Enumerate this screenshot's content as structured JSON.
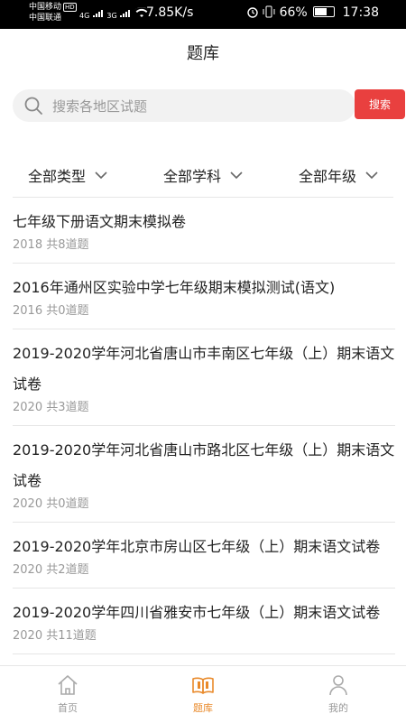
{
  "status_bar": {
    "carrier1": "中国移动",
    "carrier1_badge": "HD",
    "carrier2": "中国联通",
    "network": "4G",
    "network2": "3G",
    "speed": "7.85K/s",
    "battery": "66%",
    "time": "17:38"
  },
  "header": {
    "title": "题库"
  },
  "search": {
    "placeholder": "搜索各地区试题",
    "value": "",
    "button_label": "搜索"
  },
  "filters": [
    "全部类型",
    "全部学科",
    "全部年级"
  ],
  "list": [
    {
      "title": "七年级下册语文期末模拟卷",
      "meta": "2018 共8道题"
    },
    {
      "title": "2016年通州区实验中学七年级期末模拟测试(语文)",
      "meta": "2016 共0道题"
    },
    {
      "title": "2019-2020学年河北省唐山市丰南区七年级（上）期末语文试卷",
      "meta": "2020 共3道题"
    },
    {
      "title": "2019-2020学年河北省唐山市路北区七年级（上）期末语文试卷",
      "meta": "2020 共0道题"
    },
    {
      "title": "2019-2020学年北京市房山区七年级（上）期末语文试卷",
      "meta": "2020 共2道题"
    },
    {
      "title": "2019-2020学年四川省雅安市七年级（上）期末语文试卷",
      "meta": "2020 共11道题"
    }
  ],
  "bottom_nav": [
    {
      "label": "首页",
      "icon": "home-icon",
      "active": false
    },
    {
      "label": "题库",
      "icon": "book-icon",
      "active": true
    },
    {
      "label": "我的",
      "icon": "user-icon",
      "active": false
    }
  ],
  "colors": {
    "accent": "#e9403f",
    "nav_active": "#e98a2b",
    "muted": "#999999"
  }
}
